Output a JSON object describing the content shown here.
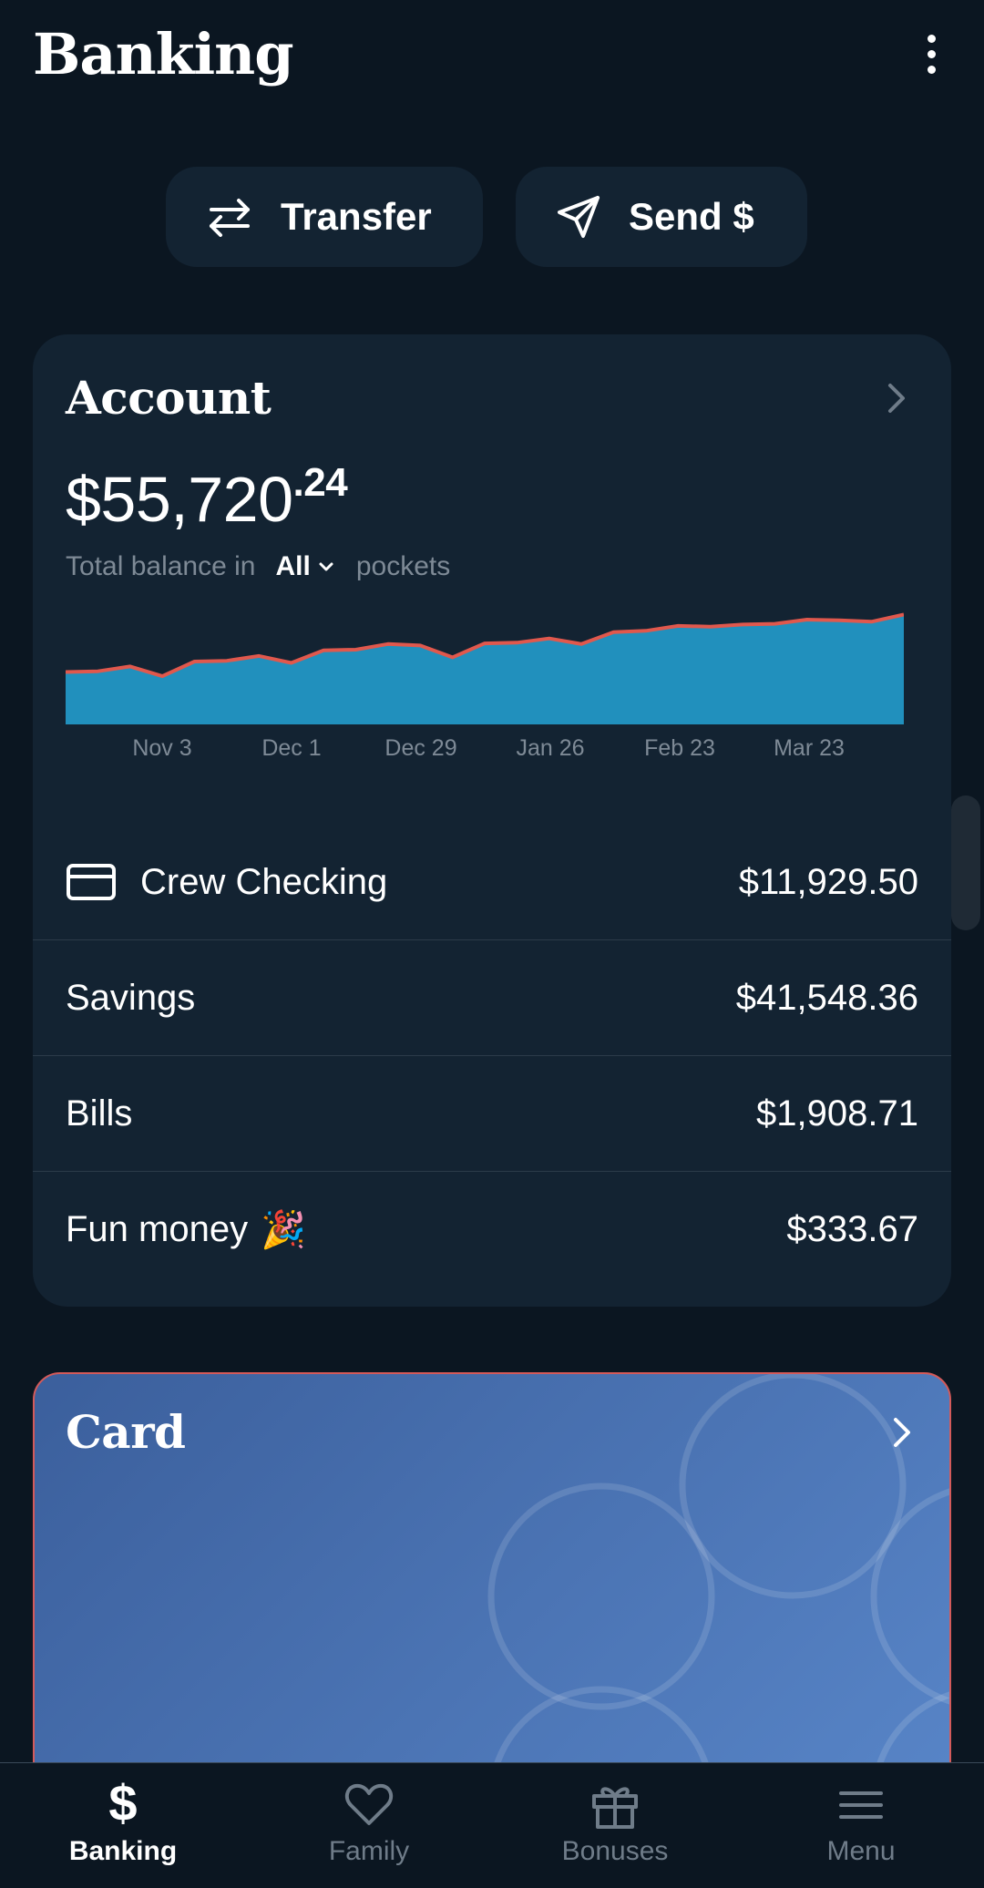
{
  "header": {
    "title": "Banking",
    "overflow_icon": "more-vertical-icon"
  },
  "actions": [
    {
      "label": "Transfer",
      "icon": "transfer-arrows-icon"
    },
    {
      "label": "Send $",
      "icon": "send-plane-icon"
    }
  ],
  "account": {
    "title": "Account",
    "balance_main": "$55,720",
    "balance_cents": ".24",
    "balance_prefix": "Total balance in",
    "pocket_filter": "All",
    "balance_suffix": "pockets",
    "pockets": [
      {
        "name": "Crew Checking",
        "amount": "$11,929.50",
        "icon": "card-icon"
      },
      {
        "name": "Savings",
        "amount": "$41,548.36"
      },
      {
        "name": "Bills",
        "amount": "$1,908.71"
      },
      {
        "name": "Fun money",
        "emoji": "🎉",
        "amount": "$333.67"
      }
    ]
  },
  "chart_data": {
    "type": "area",
    "title": "",
    "xlabel": "",
    "ylabel": "",
    "x_tick_labels": [
      "Nov 3",
      "Dec 1",
      "Dec 29",
      "Jan 26",
      "Feb 23",
      "Mar 23"
    ],
    "grid": false,
    "colors": {
      "fill": "#2190bd",
      "line": "#e0584d"
    },
    "series": [
      {
        "values": [
          47.5,
          47.6,
          48.3,
          46.9,
          49.0,
          49.1,
          49.8,
          48.8,
          50.6,
          50.7,
          51.5,
          51.3,
          49.6,
          51.6,
          51.7,
          52.3,
          51.5,
          53.2,
          53.4,
          54.1,
          54.0,
          54.3,
          54.4,
          55.0,
          54.9,
          54.7,
          55.72
        ]
      }
    ]
  },
  "card_section": {
    "title": "Card"
  },
  "bottom_nav": [
    {
      "label": "Banking",
      "icon": "dollar-icon",
      "active": true
    },
    {
      "label": "Family",
      "icon": "heart-icon",
      "active": false
    },
    {
      "label": "Bonuses",
      "icon": "gift-icon",
      "active": false
    },
    {
      "label": "Menu",
      "icon": "hamburger-menu-icon",
      "active": false
    }
  ]
}
